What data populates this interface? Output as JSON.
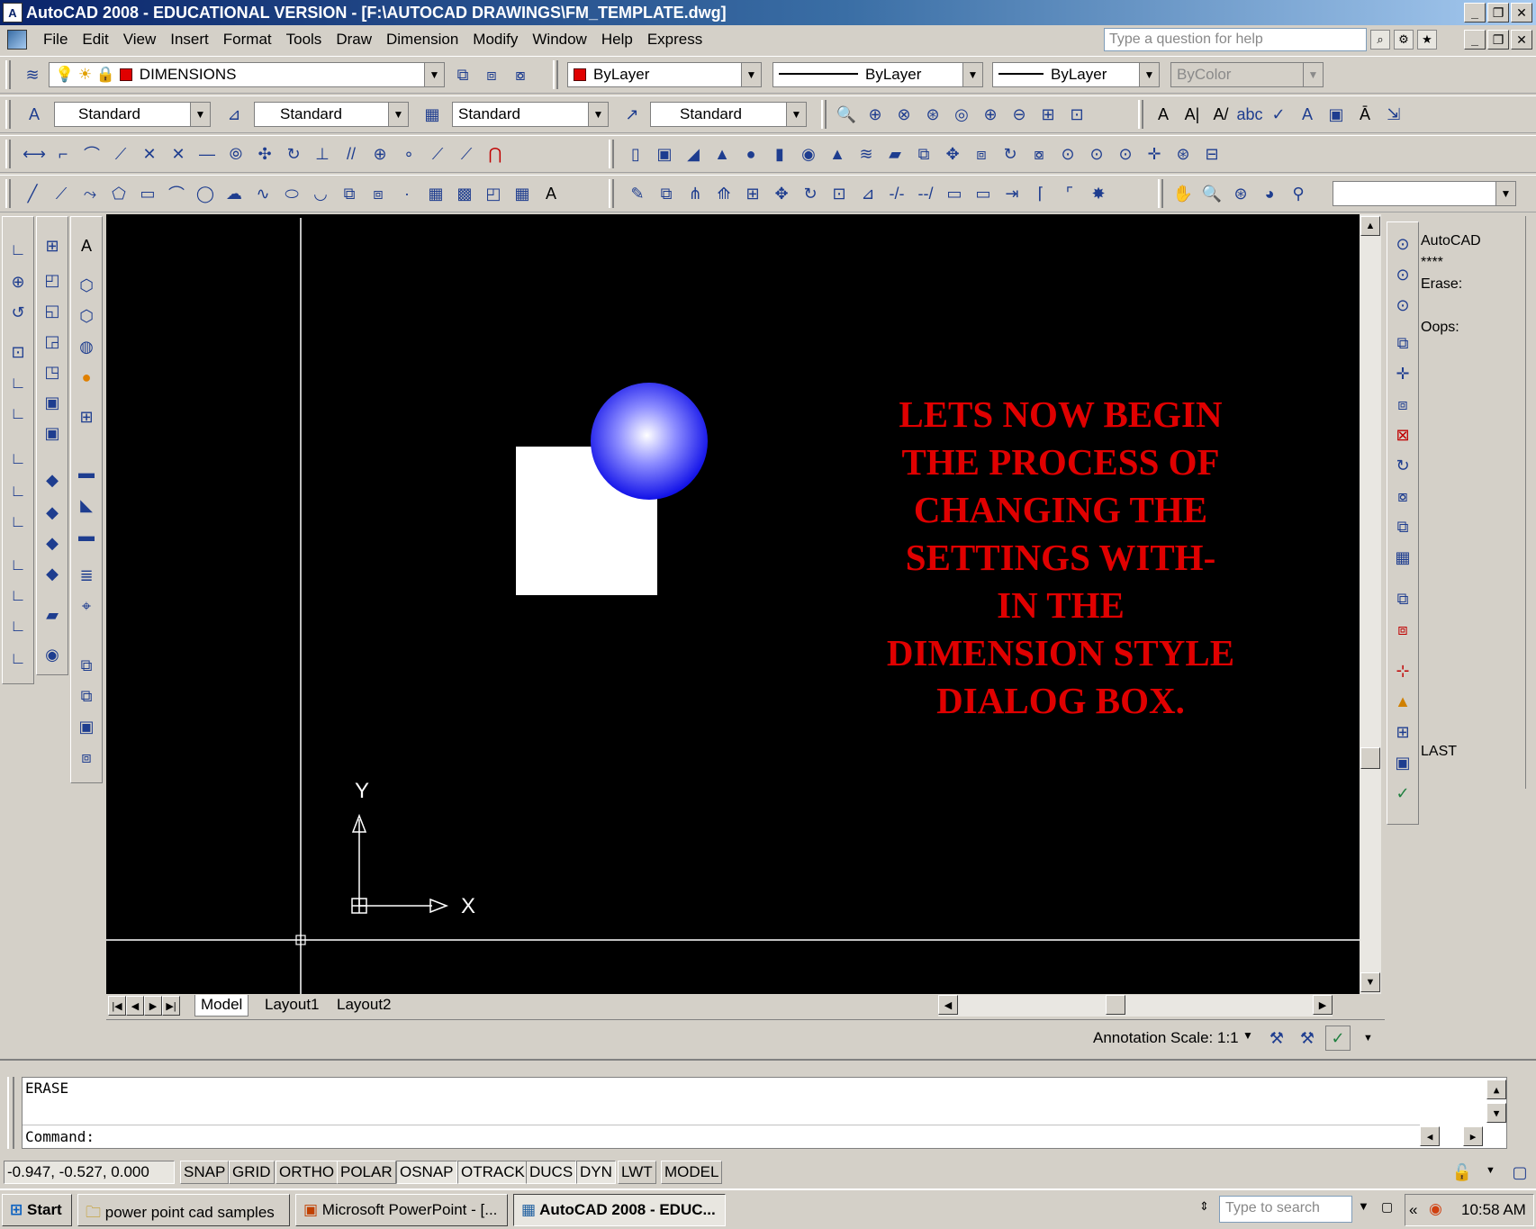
{
  "window": {
    "title": "AutoCAD 2008 - EDUCATIONAL VERSION - [F:\\AUTOCAD DRAWINGS\\FM_TEMPLATE.dwg]"
  },
  "menu": {
    "items": [
      "File",
      "Edit",
      "View",
      "Insert",
      "Format",
      "Tools",
      "Draw",
      "Dimension",
      "Modify",
      "Window",
      "Help",
      "Express"
    ],
    "help_placeholder": "Type a question for help"
  },
  "layers_toolbar": {
    "layer": "DIMENSIONS",
    "color": "ByLayer",
    "linetype": "ByLayer",
    "lineweight": "ByLayer",
    "plotstyle": "ByColor"
  },
  "styles_toolbar": {
    "text_style": "Standard",
    "dim_style": "Standard",
    "table_style": "Standard",
    "multileader_style": "Standard"
  },
  "overlay": {
    "lines": [
      "LETS NOW BEGIN",
      "THE PROCESS OF",
      "CHANGING THE",
      "SETTINGS WITH-",
      "IN THE",
      "DIMENSION STYLE",
      "DIALOG BOX."
    ],
    "color": "#e00000"
  },
  "ucs": {
    "x_label": "X",
    "y_label": "Y"
  },
  "tool_palette": {
    "lines": [
      "AutoCAD",
      "****",
      "Erase:",
      "Oops:"
    ],
    "last_label": "LAST"
  },
  "tabs": [
    "Model",
    "Layout1",
    "Layout2"
  ],
  "annotation": {
    "label": "Annotation Scale:",
    "scale": "1:1"
  },
  "command": {
    "history": "ERASE",
    "prompt": "Command:"
  },
  "status": {
    "coords": "-0.947, -0.527, 0.000",
    "toggles": [
      "SNAP",
      "GRID",
      "ORTHO",
      "POLAR",
      "OSNAP",
      "OTRACK",
      "DUCS",
      "DYN",
      "LWT",
      "MODEL"
    ]
  },
  "taskbar": {
    "start": "Start",
    "tasks": [
      "power point cad samples",
      "Microsoft PowerPoint - [...",
      "AutoCAD 2008 - EDUC..."
    ],
    "search_placeholder": "Type to search",
    "time": "10:58 AM"
  }
}
